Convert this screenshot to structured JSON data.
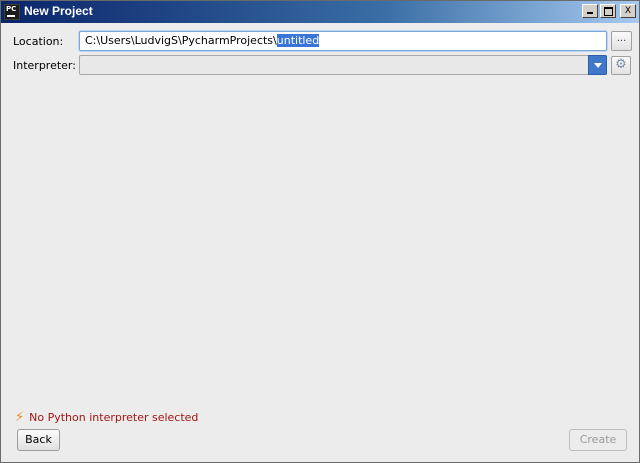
{
  "window": {
    "app_icon_text": "PC",
    "title": "New Project",
    "controls": {
      "minimize": "_",
      "maximize": "□",
      "close": "X"
    }
  },
  "form": {
    "location": {
      "label": "Location:",
      "value_prefix": "C:\\Users\\LudvigS\\PycharmProjects\\",
      "value_selected": "untitled",
      "browse_label": "..."
    },
    "interpreter": {
      "label": "Interpreter:",
      "value": ""
    }
  },
  "status": {
    "message": "No Python interpreter selected"
  },
  "footer": {
    "back_label": "Back",
    "create_label": "Create"
  },
  "colors": {
    "error_text": "#a31515",
    "warning_icon": "#e08a1e",
    "accent": "#3f78c9"
  }
}
